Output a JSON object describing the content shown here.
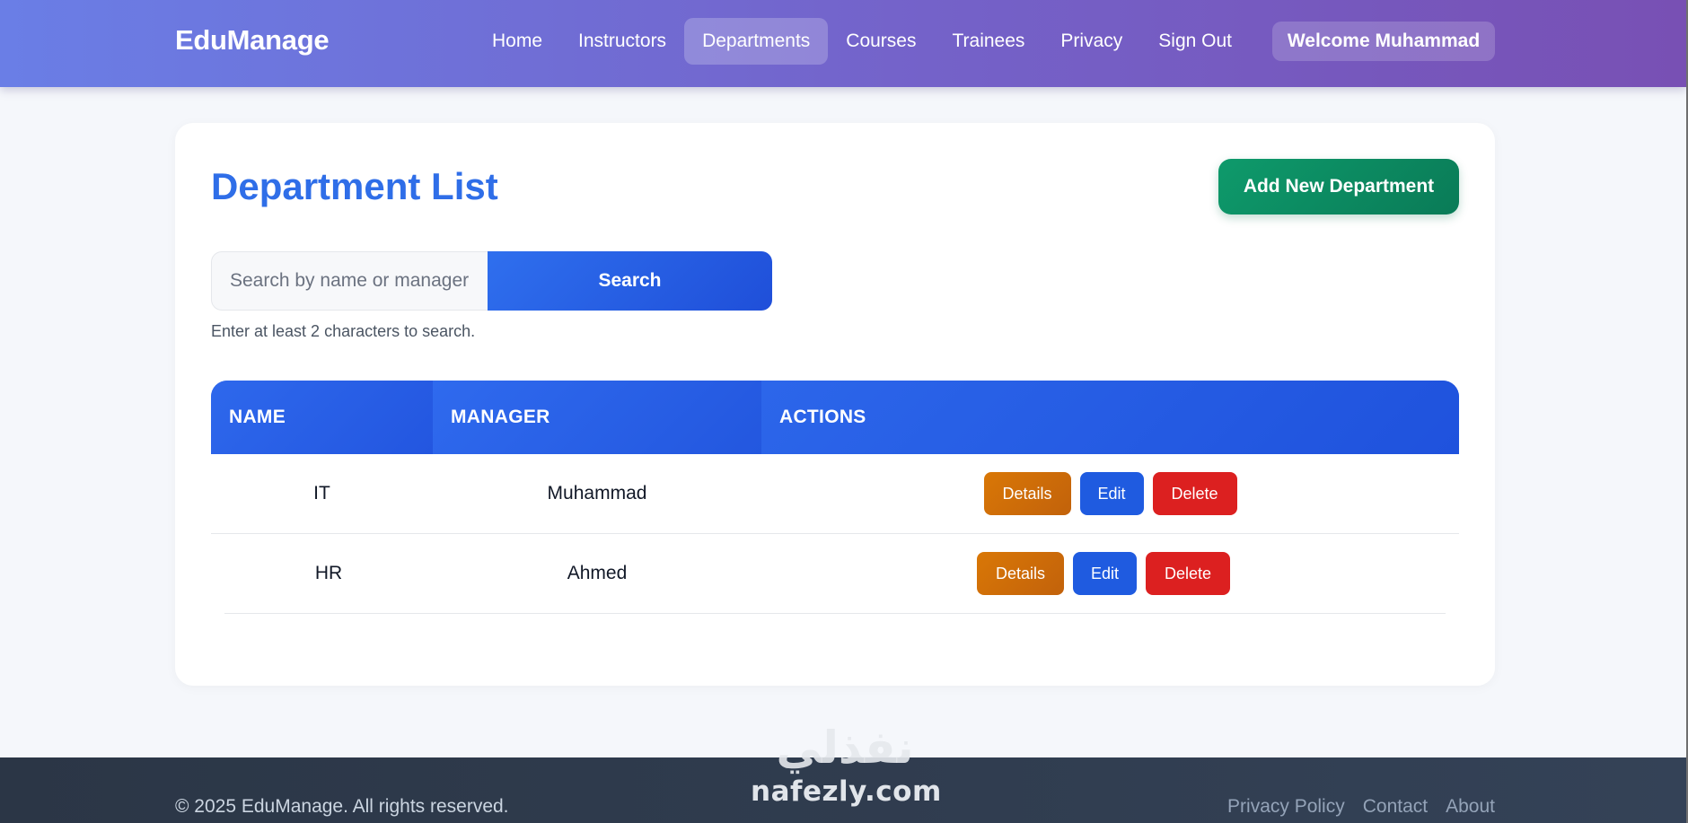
{
  "navbar": {
    "brand": "EduManage",
    "links": [
      {
        "label": "Home",
        "active": false
      },
      {
        "label": "Instructors",
        "active": false
      },
      {
        "label": "Departments",
        "active": true
      },
      {
        "label": "Courses",
        "active": false
      },
      {
        "label": "Trainees",
        "active": false
      },
      {
        "label": "Privacy",
        "active": false
      },
      {
        "label": "Sign Out",
        "active": false
      }
    ],
    "welcome": "Welcome Muhammad"
  },
  "main": {
    "title": "Department List",
    "add_button_label": "Add New Department",
    "search": {
      "placeholder": "Search by name or manager",
      "value": "",
      "button_label": "Search",
      "hint": "Enter at least 2 characters to search."
    },
    "table": {
      "columns": [
        "NAME",
        "MANAGER",
        "ACTIONS"
      ],
      "rows": [
        {
          "name": "IT",
          "manager": "Muhammad"
        },
        {
          "name": "HR",
          "manager": "Ahmed"
        }
      ],
      "actions": {
        "details": "Details",
        "edit": "Edit",
        "delete": "Delete"
      }
    }
  },
  "footer": {
    "copyright": "© 2025 EduManage. All rights reserved.",
    "links": [
      "Privacy Policy",
      "Contact",
      "About"
    ]
  },
  "watermark": {
    "arabic": "نفذلي",
    "latin": "nafezly.com"
  },
  "colors": {
    "nav_gradient_start": "#6a7ee6",
    "nav_gradient_end": "#7850b4",
    "title_blue": "#2f6ee8",
    "primary_blue": "#2257e0",
    "add_green": "#0e9a6b",
    "details_orange": "#d97706",
    "delete_red": "#dc2020",
    "footer_bg": "#2b3646"
  }
}
